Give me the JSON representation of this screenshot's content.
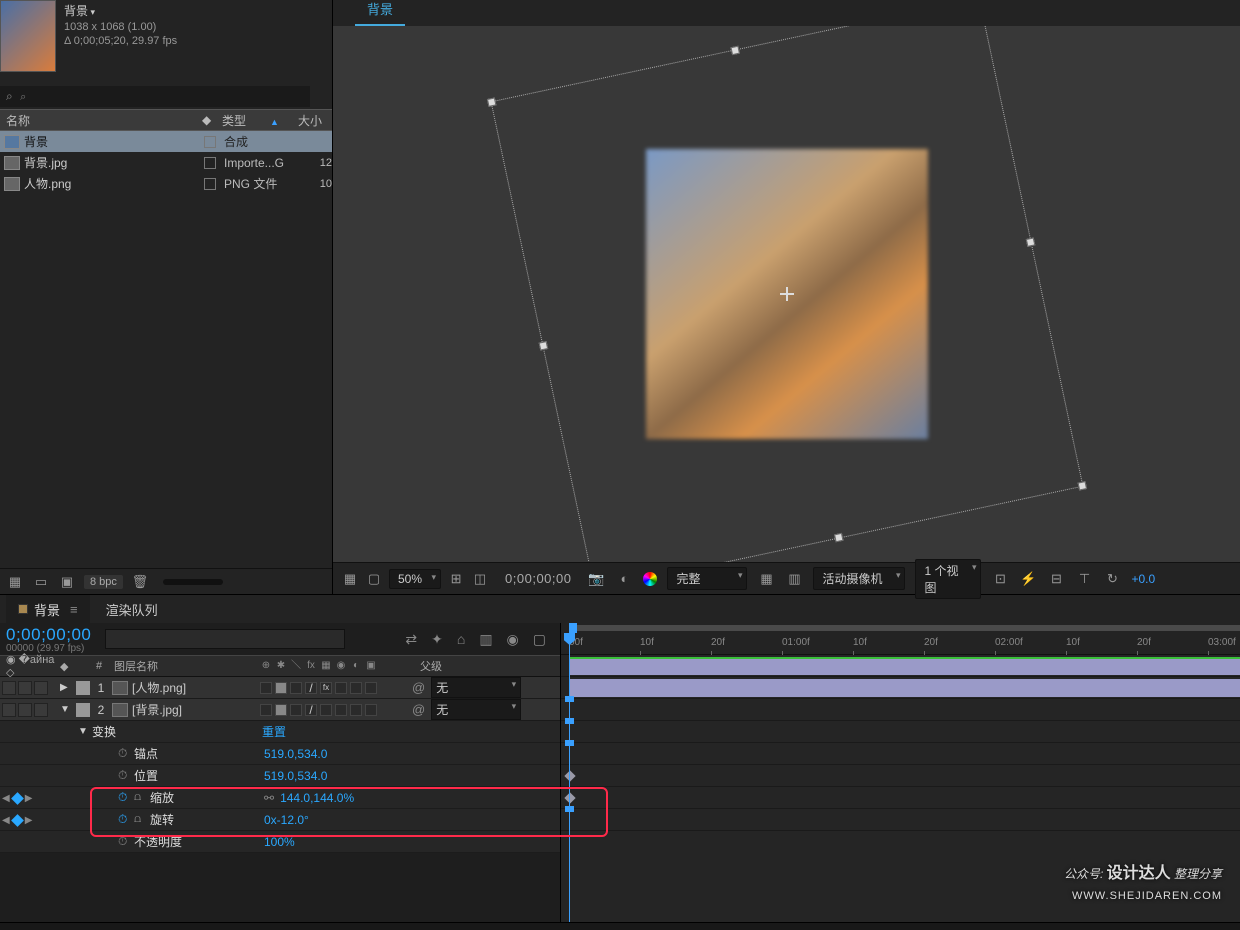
{
  "project": {
    "comp_name": "背景",
    "dimensions": "1038 x 1068 (1.00)",
    "delta": "Δ 0;00;05;20, 29.97 fps",
    "search_placeholder": "⌕"
  },
  "project_table": {
    "cols": {
      "name": "名称",
      "type": "类型",
      "size": "大小"
    },
    "rows": [
      {
        "name": "背景",
        "type": "合成",
        "size": "",
        "selected": true,
        "icon": "comp"
      },
      {
        "name": "背景.jpg",
        "type": "Importe...G",
        "size": "12",
        "selected": false,
        "icon": "jpg"
      },
      {
        "name": "人物.png",
        "type": "PNG 文件",
        "size": "10",
        "selected": false,
        "icon": "png"
      }
    ]
  },
  "project_footer": {
    "bpc": "8 bpc"
  },
  "viewer": {
    "tab": "背景",
    "footer": {
      "zoom": "50%",
      "timecode": "0;00;00;00",
      "quality": "完整",
      "camera": "活动摄像机",
      "views": "1 个视图",
      "exposure": "+0.0"
    }
  },
  "timeline": {
    "tabs": {
      "active": "背景",
      "render": "渲染队列"
    },
    "current_tc": "0;00;00;00",
    "frame_fps": "00000 (29.97 fps)",
    "col_headers": {
      "num": "#",
      "name": "图层名称",
      "parent": "父级"
    },
    "layers": [
      {
        "num": "1",
        "name": "[人物.png]",
        "parent": "无"
      },
      {
        "num": "2",
        "name": "[背景.jpg]",
        "parent": "无"
      }
    ],
    "transform": {
      "group": "变换",
      "reset": "重置",
      "anchor": {
        "label": "锚点",
        "value": "519.0,534.0"
      },
      "position": {
        "label": "位置",
        "value": "519.0,534.0"
      },
      "scale": {
        "label": "缩放",
        "value": "144.0,144.0%"
      },
      "rotation": {
        "label": "旋转",
        "value": "0x-12.0°"
      },
      "opacity": {
        "label": "不透明度",
        "value": "100%"
      }
    },
    "ruler_ticks": [
      "00f",
      "10f",
      "20f",
      "01:00f",
      "10f",
      "20f",
      "02:00f",
      "10f",
      "20f",
      "03:00f"
    ]
  },
  "watermark": {
    "line1": "公众号:",
    "line2": "设计达人",
    "line3": "整理分享",
    "url": "WWW.SHEJIDAREN.COM"
  }
}
